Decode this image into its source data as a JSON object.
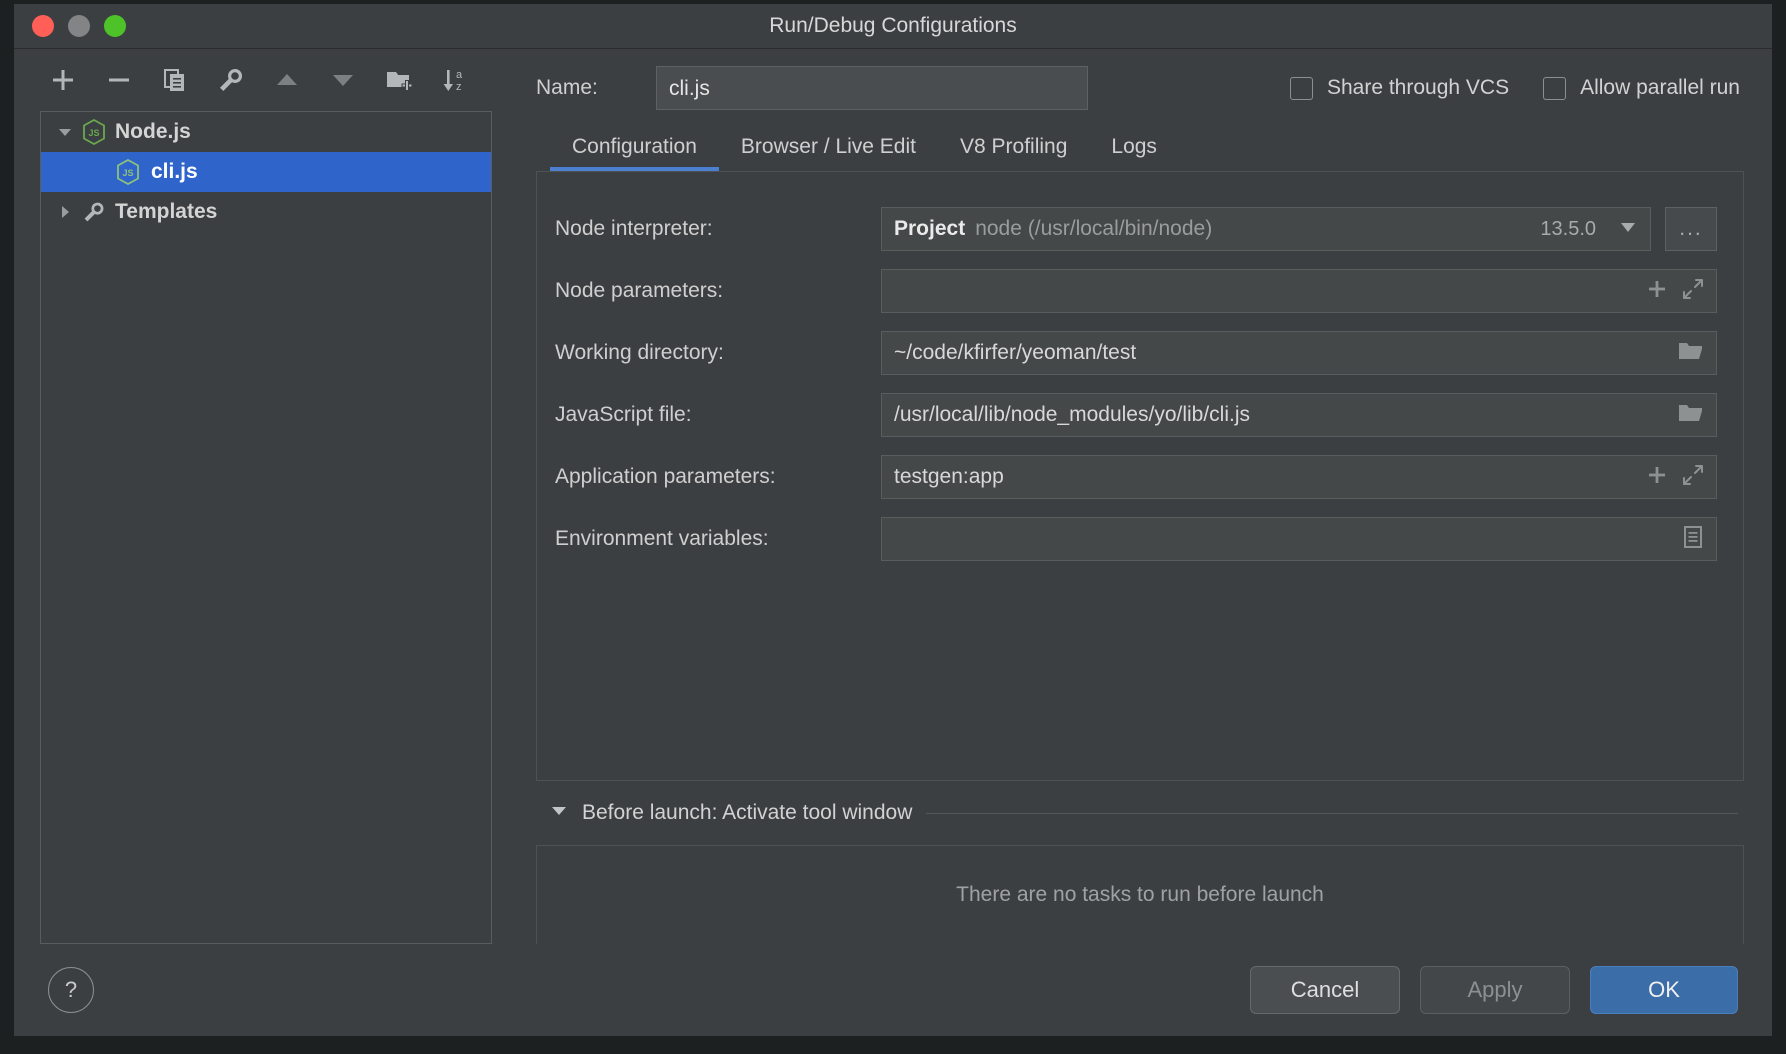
{
  "window": {
    "title": "Run/Debug Configurations"
  },
  "traffic": {
    "close": "close-button",
    "minimize": "minimize-button",
    "zoom": "zoom-button"
  },
  "toolbar": {
    "items": [
      {
        "name": "add-configuration-button",
        "icon": "plus-icon"
      },
      {
        "name": "remove-configuration-button",
        "icon": "minus-icon"
      },
      {
        "name": "copy-configuration-button",
        "icon": "copy-icon"
      },
      {
        "name": "edit-templates-button",
        "icon": "wrench-icon"
      },
      {
        "name": "move-up-button",
        "icon": "triangle-up-icon"
      },
      {
        "name": "move-down-button",
        "icon": "triangle-down-icon"
      },
      {
        "name": "new-folder-button",
        "icon": "folder-plus-icon"
      },
      {
        "name": "sort-configurations-button",
        "icon": "sort-az-icon"
      }
    ]
  },
  "tree": {
    "nodes": [
      {
        "label": "Node.js",
        "icon": "nodejs-icon",
        "expanded": true,
        "selected": false,
        "child": false
      },
      {
        "label": "cli.js",
        "icon": "nodejs-icon",
        "expanded": false,
        "selected": true,
        "child": true
      },
      {
        "label": "Templates",
        "icon": "wrench-icon",
        "expanded": false,
        "selected": false,
        "child": false
      }
    ]
  },
  "name_row": {
    "label": "Name:",
    "value": "cli.js",
    "placeholder": "",
    "share_vcs_label": "Share through VCS",
    "share_vcs_checked": false,
    "allow_parallel_label": "Allow parallel run",
    "allow_parallel_checked": false
  },
  "tabs": [
    {
      "label": "Configuration",
      "active": true
    },
    {
      "label": "Browser / Live Edit",
      "active": false
    },
    {
      "label": "V8 Profiling",
      "active": false
    },
    {
      "label": "Logs",
      "active": false
    }
  ],
  "fields": {
    "node_interpreter": {
      "label": "Node interpreter:",
      "scope": "Project",
      "path": "node (/usr/local/bin/node)",
      "version": "13.5.0",
      "browse_label": "...",
      "dropdown_icon": "chevron-down-icon"
    },
    "node_parameters": {
      "label": "Node parameters:",
      "value": "",
      "icons": [
        "plus-icon",
        "expand-icon"
      ]
    },
    "working_directory": {
      "label": "Working directory:",
      "value": "~/code/kfirfer/yeoman/test",
      "icons": [
        "folder-icon"
      ]
    },
    "javascript_file": {
      "label": "JavaScript file:",
      "value": "/usr/local/lib/node_modules/yo/lib/cli.js",
      "icons": [
        "folder-icon"
      ]
    },
    "application_parameters": {
      "label": "Application parameters:",
      "value": "testgen:app",
      "icons": [
        "plus-icon",
        "expand-icon"
      ]
    },
    "environment_variables": {
      "label": "Environment variables:",
      "value": "",
      "icons": [
        "environment-list-icon"
      ]
    }
  },
  "before_launch": {
    "title": "Before launch: Activate tool window",
    "expanded": true,
    "empty_message": "There are no tasks to run before launch"
  },
  "footer": {
    "help_label": "?",
    "cancel_label": "Cancel",
    "apply_label": "Apply",
    "apply_enabled": false,
    "ok_label": "OK"
  },
  "colors": {
    "accent": "#2f65ca",
    "tab_underline": "#4d7fd1",
    "primary_button": "#3b6ea8",
    "nodejs_green": "#6aa84f",
    "window_bg": "#3c3f41"
  }
}
